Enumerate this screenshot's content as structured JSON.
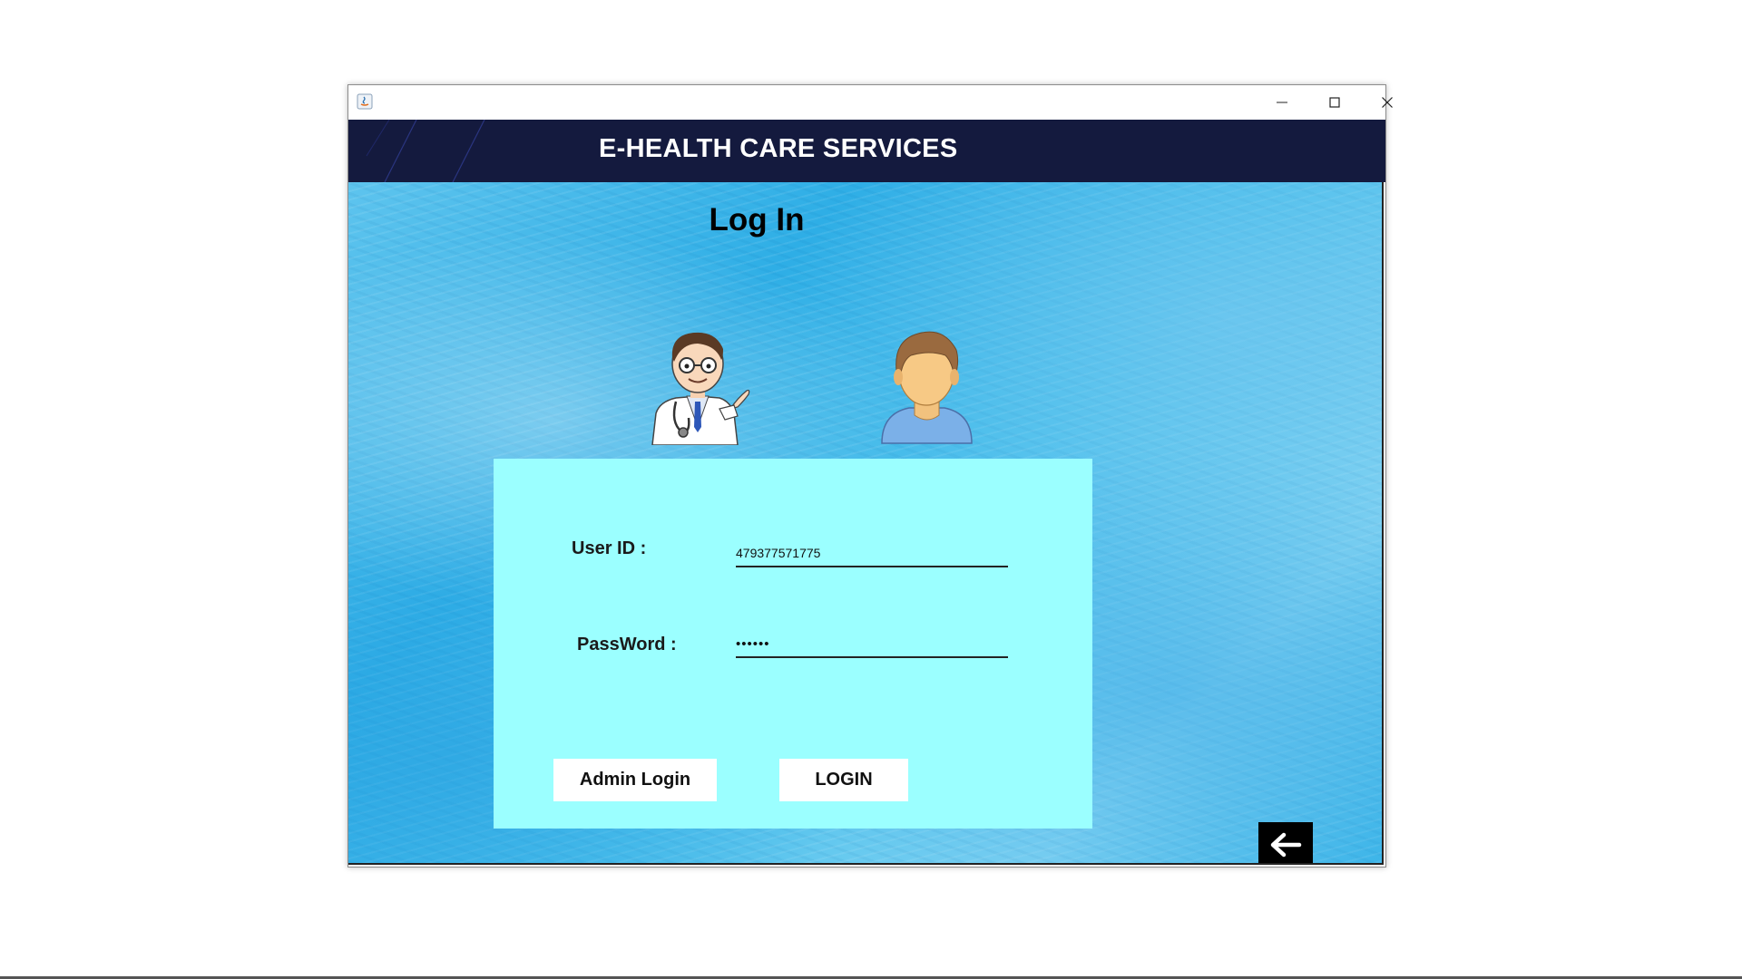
{
  "window": {
    "controls": {
      "minimize_icon": "minimize-icon",
      "maximize_icon": "maximize-icon",
      "close_icon": "close-icon"
    }
  },
  "header": {
    "title": "E-HEALTH CARE SERVICES",
    "background": "#141a3e"
  },
  "main": {
    "heading": "Log In",
    "doctor_icon": "doctor-illustration-icon",
    "patient_icon": "patient-avatar-icon"
  },
  "form": {
    "user_id_label": "User ID :",
    "user_id_value": "479377571775",
    "password_label": "PassWord :",
    "password_value": "••••••",
    "panel_color": "#9bffff"
  },
  "buttons": {
    "admin_login": "Admin Login",
    "login": "LOGIN",
    "back_icon": "arrow-left-icon"
  }
}
